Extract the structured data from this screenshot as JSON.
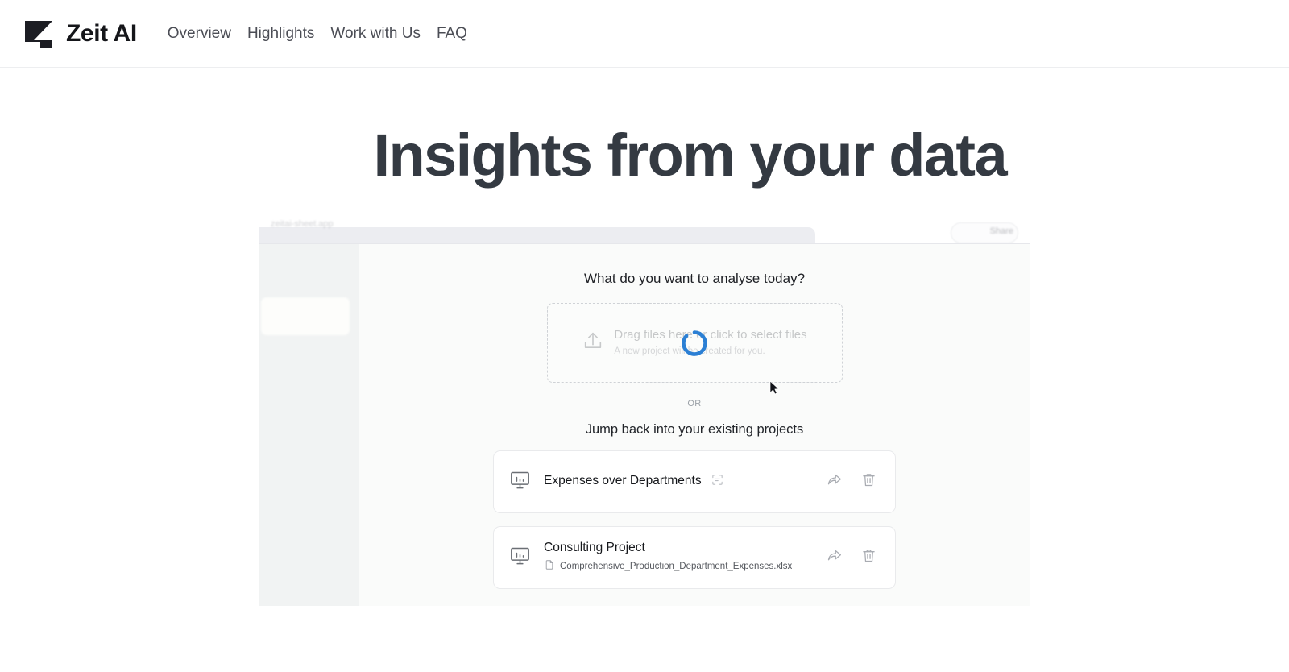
{
  "nav": {
    "brand": "Zeit AI",
    "logo_icon": "zeit-z-logo",
    "links": [
      {
        "label": "Overview"
      },
      {
        "label": "Highlights"
      },
      {
        "label": "Work with Us"
      },
      {
        "label": "FAQ"
      }
    ]
  },
  "hero": {
    "title": "Insights from your data"
  },
  "screenshot": {
    "browser": {
      "url_text": "zeitai-sheet.app",
      "share_button": "Share"
    },
    "app": {
      "heading": "What do you want to analyse today?",
      "dropzone": {
        "icon": "upload-icon",
        "primary": "Drag files here or click to select files",
        "secondary": "A new project will be created for you.",
        "loading": true,
        "spinner_color": "#2b7fd4"
      },
      "or_label": "OR",
      "projects_heading": "Jump back into your existing projects",
      "projects": [
        {
          "icon": "monitor-chart-icon",
          "title": "Expenses over Departments",
          "rename_icon": "rename-icon",
          "file": null,
          "share_icon": "share-icon",
          "delete_icon": "trash-icon"
        },
        {
          "icon": "monitor-chart-icon",
          "title": "Consulting Project",
          "rename_icon": null,
          "file": "Comprehensive_Production_Department_Expenses.xlsx",
          "file_icon": "xls-file-icon",
          "share_icon": "share-icon",
          "delete_icon": "trash-icon"
        }
      ]
    },
    "cursor": "mouse-pointer"
  },
  "colors": {
    "text_dark": "#343a42",
    "brand_dark": "#15161a",
    "nav_link": "#4b4d55",
    "accent_blue": "#2b7fd4"
  }
}
